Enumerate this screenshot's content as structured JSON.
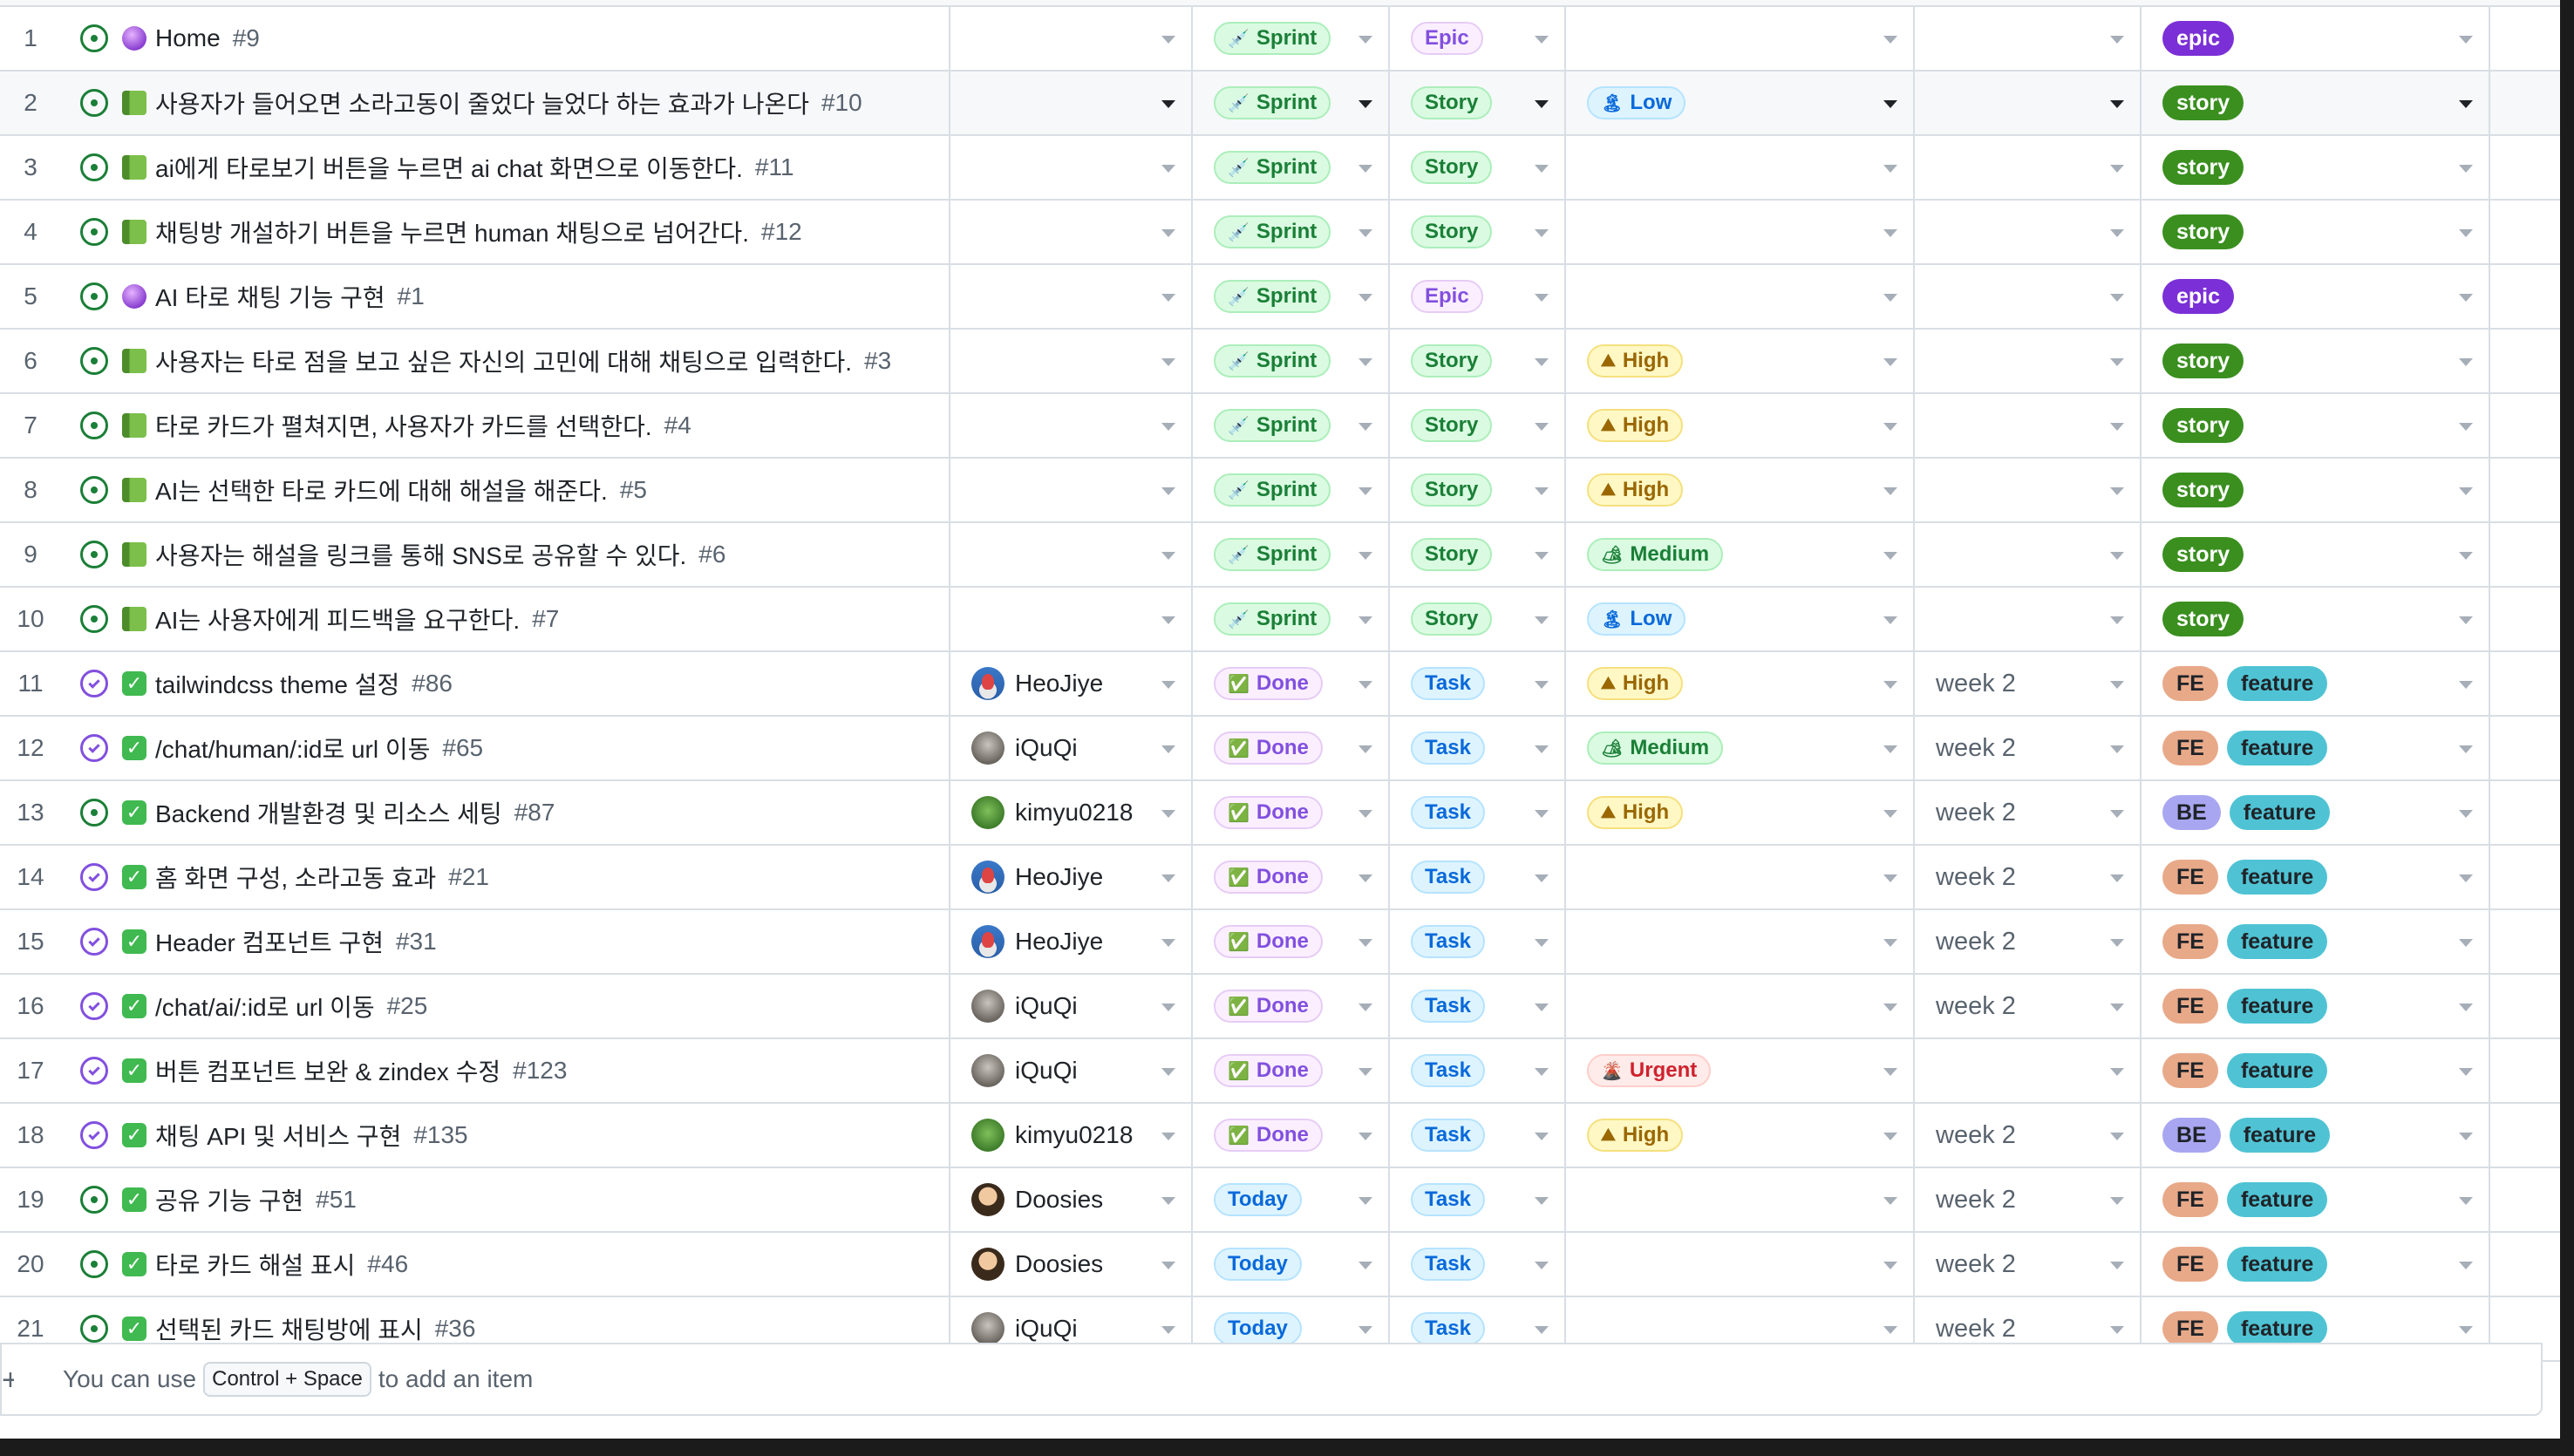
{
  "rows": [
    {
      "num": "1",
      "state": "open",
      "emoji": "crystal",
      "title": "Home",
      "id": "#9",
      "assignee": null,
      "status": {
        "label": "Sprint",
        "kind": "sprint"
      },
      "type": {
        "label": "Epic",
        "kind": "epic"
      },
      "priority": null,
      "iteration": "",
      "labels": [
        {
          "text": "epic",
          "kind": "epic"
        }
      ]
    },
    {
      "num": "2",
      "state": "open",
      "emoji": "book",
      "title": "사용자가 들어오면 소라고동이 줄었다 늘었다 하는 효과가 나온다",
      "id": "#10",
      "assignee": null,
      "status": {
        "label": "Sprint",
        "kind": "sprint"
      },
      "type": {
        "label": "Story",
        "kind": "story"
      },
      "priority": {
        "label": "Low",
        "kind": "low",
        "icon": "🏝"
      },
      "iteration": "",
      "labels": [
        {
          "text": "story",
          "kind": "story"
        }
      ],
      "hover": true
    },
    {
      "num": "3",
      "state": "open",
      "emoji": "book",
      "title": "ai에게 타로보기 버튼을 누르면 ai chat 화면으로 이동한다.",
      "id": "#11",
      "assignee": null,
      "status": {
        "label": "Sprint",
        "kind": "sprint"
      },
      "type": {
        "label": "Story",
        "kind": "story"
      },
      "priority": null,
      "iteration": "",
      "labels": [
        {
          "text": "story",
          "kind": "story"
        }
      ]
    },
    {
      "num": "4",
      "state": "open",
      "emoji": "book",
      "title": "채팅방 개설하기 버튼을 누르면 human 채팅으로 넘어간다.",
      "id": "#12",
      "assignee": null,
      "status": {
        "label": "Sprint",
        "kind": "sprint"
      },
      "type": {
        "label": "Story",
        "kind": "story"
      },
      "priority": null,
      "iteration": "",
      "labels": [
        {
          "text": "story",
          "kind": "story"
        }
      ]
    },
    {
      "num": "5",
      "state": "open",
      "emoji": "crystal",
      "title": "AI 타로 채팅 기능 구현",
      "id": "#1",
      "assignee": null,
      "status": {
        "label": "Sprint",
        "kind": "sprint"
      },
      "type": {
        "label": "Epic",
        "kind": "epic"
      },
      "priority": null,
      "iteration": "",
      "labels": [
        {
          "text": "epic",
          "kind": "epic"
        }
      ]
    },
    {
      "num": "6",
      "state": "open",
      "emoji": "book",
      "title": "사용자는 타로 점을 보고 싶은 자신의 고민에 대해 채팅으로 입력한다.",
      "id": "#3",
      "assignee": null,
      "status": {
        "label": "Sprint",
        "kind": "sprint"
      },
      "type": {
        "label": "Story",
        "kind": "story"
      },
      "priority": {
        "label": "High",
        "kind": "high",
        "icon": "⛰"
      },
      "iteration": "",
      "labels": [
        {
          "text": "story",
          "kind": "story"
        }
      ]
    },
    {
      "num": "7",
      "state": "open",
      "emoji": "book",
      "title": "타로 카드가 펼쳐지면, 사용자가 카드를 선택한다.",
      "id": "#4",
      "assignee": null,
      "status": {
        "label": "Sprint",
        "kind": "sprint"
      },
      "type": {
        "label": "Story",
        "kind": "story"
      },
      "priority": {
        "label": "High",
        "kind": "high",
        "icon": "⛰"
      },
      "iteration": "",
      "labels": [
        {
          "text": "story",
          "kind": "story"
        }
      ]
    },
    {
      "num": "8",
      "state": "open",
      "emoji": "book",
      "title": "AI는 선택한 타로 카드에 대해 해설을 해준다.",
      "id": "#5",
      "assignee": null,
      "status": {
        "label": "Sprint",
        "kind": "sprint"
      },
      "type": {
        "label": "Story",
        "kind": "story"
      },
      "priority": {
        "label": "High",
        "kind": "high",
        "icon": "⛰"
      },
      "iteration": "",
      "labels": [
        {
          "text": "story",
          "kind": "story"
        }
      ]
    },
    {
      "num": "9",
      "state": "open",
      "emoji": "book",
      "title": "사용자는 해설을 링크를 통해 SNS로 공유할 수 있다.",
      "id": "#6",
      "assignee": null,
      "status": {
        "label": "Sprint",
        "kind": "sprint"
      },
      "type": {
        "label": "Story",
        "kind": "story"
      },
      "priority": {
        "label": "Medium",
        "kind": "medium",
        "icon": "🏕"
      },
      "iteration": "",
      "labels": [
        {
          "text": "story",
          "kind": "story"
        }
      ]
    },
    {
      "num": "10",
      "state": "open",
      "emoji": "book",
      "title": "AI는 사용자에게 피드백을 요구한다.",
      "id": "#7",
      "assignee": null,
      "status": {
        "label": "Sprint",
        "kind": "sprint"
      },
      "type": {
        "label": "Story",
        "kind": "story"
      },
      "priority": {
        "label": "Low",
        "kind": "low",
        "icon": "🏝"
      },
      "iteration": "",
      "labels": [
        {
          "text": "story",
          "kind": "story"
        }
      ]
    },
    {
      "num": "11",
      "state": "closed",
      "emoji": "check",
      "title": "tailwindcss theme 설정",
      "id": "#86",
      "assignee": {
        "name": "HeoJiye",
        "av": "heo"
      },
      "status": {
        "label": "Done",
        "kind": "done"
      },
      "type": {
        "label": "Task",
        "kind": "task"
      },
      "priority": {
        "label": "High",
        "kind": "high",
        "icon": "⛰"
      },
      "iteration": "week 2",
      "labels": [
        {
          "text": "FE",
          "kind": "fe"
        },
        {
          "text": "feature",
          "kind": "feature"
        }
      ]
    },
    {
      "num": "12",
      "state": "closed",
      "emoji": "check",
      "title": "/chat/human/:id로 url 이동",
      "id": "#65",
      "assignee": {
        "name": "iQuQi",
        "av": "iqu"
      },
      "status": {
        "label": "Done",
        "kind": "done"
      },
      "type": {
        "label": "Task",
        "kind": "task"
      },
      "priority": {
        "label": "Medium",
        "kind": "medium",
        "icon": "🏕"
      },
      "iteration": "week 2",
      "labels": [
        {
          "text": "FE",
          "kind": "fe"
        },
        {
          "text": "feature",
          "kind": "feature"
        }
      ]
    },
    {
      "num": "13",
      "state": "open",
      "emoji": "check",
      "title": "Backend 개발환경 및 리소스 세팅",
      "id": "#87",
      "assignee": {
        "name": "kimyu0218",
        "av": "kim"
      },
      "status": {
        "label": "Done",
        "kind": "done"
      },
      "type": {
        "label": "Task",
        "kind": "task"
      },
      "priority": {
        "label": "High",
        "kind": "high",
        "icon": "⛰"
      },
      "iteration": "week 2",
      "labels": [
        {
          "text": "BE",
          "kind": "be"
        },
        {
          "text": "feature",
          "kind": "feature"
        }
      ]
    },
    {
      "num": "14",
      "state": "closed",
      "emoji": "check",
      "title": "홈 화면 구성, 소라고동 효과",
      "id": "#21",
      "assignee": {
        "name": "HeoJiye",
        "av": "heo"
      },
      "status": {
        "label": "Done",
        "kind": "done"
      },
      "type": {
        "label": "Task",
        "kind": "task"
      },
      "priority": null,
      "iteration": "week 2",
      "labels": [
        {
          "text": "FE",
          "kind": "fe"
        },
        {
          "text": "feature",
          "kind": "feature"
        }
      ]
    },
    {
      "num": "15",
      "state": "closed",
      "emoji": "check",
      "title": "Header 컴포넌트 구현",
      "id": "#31",
      "assignee": {
        "name": "HeoJiye",
        "av": "heo"
      },
      "status": {
        "label": "Done",
        "kind": "done"
      },
      "type": {
        "label": "Task",
        "kind": "task"
      },
      "priority": null,
      "iteration": "week 2",
      "labels": [
        {
          "text": "FE",
          "kind": "fe"
        },
        {
          "text": "feature",
          "kind": "feature"
        }
      ]
    },
    {
      "num": "16",
      "state": "closed",
      "emoji": "check",
      "title": "/chat/ai/:id로 url 이동",
      "id": "#25",
      "assignee": {
        "name": "iQuQi",
        "av": "iqu"
      },
      "status": {
        "label": "Done",
        "kind": "done"
      },
      "type": {
        "label": "Task",
        "kind": "task"
      },
      "priority": null,
      "iteration": "week 2",
      "labels": [
        {
          "text": "FE",
          "kind": "fe"
        },
        {
          "text": "feature",
          "kind": "feature"
        }
      ]
    },
    {
      "num": "17",
      "state": "closed",
      "emoji": "check",
      "title": "버튼 컴포넌트 보완 & zindex 수정",
      "id": "#123",
      "assignee": {
        "name": "iQuQi",
        "av": "iqu"
      },
      "status": {
        "label": "Done",
        "kind": "done"
      },
      "type": {
        "label": "Task",
        "kind": "task"
      },
      "priority": {
        "label": "Urgent",
        "kind": "urgent",
        "icon": "🌋"
      },
      "iteration": "",
      "labels": [
        {
          "text": "FE",
          "kind": "fe"
        },
        {
          "text": "feature",
          "kind": "feature"
        }
      ]
    },
    {
      "num": "18",
      "state": "closed",
      "emoji": "check",
      "title": "채팅 API 및 서비스 구현",
      "id": "#135",
      "assignee": {
        "name": "kimyu0218",
        "av": "kim"
      },
      "status": {
        "label": "Done",
        "kind": "done"
      },
      "type": {
        "label": "Task",
        "kind": "task"
      },
      "priority": {
        "label": "High",
        "kind": "high",
        "icon": "⛰"
      },
      "iteration": "week 2",
      "labels": [
        {
          "text": "BE",
          "kind": "be"
        },
        {
          "text": "feature",
          "kind": "feature"
        }
      ]
    },
    {
      "num": "19",
      "state": "open",
      "emoji": "check",
      "title": "공유 기능 구현",
      "id": "#51",
      "assignee": {
        "name": "Doosies",
        "av": "doo"
      },
      "status": {
        "label": "Today",
        "kind": "today"
      },
      "type": {
        "label": "Task",
        "kind": "task"
      },
      "priority": null,
      "iteration": "week 2",
      "labels": [
        {
          "text": "FE",
          "kind": "fe"
        },
        {
          "text": "feature",
          "kind": "feature"
        }
      ]
    },
    {
      "num": "20",
      "state": "open",
      "emoji": "check",
      "title": "타로 카드 해설 표시",
      "id": "#46",
      "assignee": {
        "name": "Doosies",
        "av": "doo"
      },
      "status": {
        "label": "Today",
        "kind": "today"
      },
      "type": {
        "label": "Task",
        "kind": "task"
      },
      "priority": null,
      "iteration": "week 2",
      "labels": [
        {
          "text": "FE",
          "kind": "fe"
        },
        {
          "text": "feature",
          "kind": "feature"
        }
      ]
    },
    {
      "num": "21",
      "state": "open",
      "emoji": "check",
      "title": "선택된 카드 채팅방에 표시",
      "id": "#36",
      "assignee": {
        "name": "iQuQi",
        "av": "iqu"
      },
      "status": {
        "label": "Today",
        "kind": "today"
      },
      "type": {
        "label": "Task",
        "kind": "task"
      },
      "priority": null,
      "iteration": "week 2",
      "labels": [
        {
          "text": "FE",
          "kind": "fe"
        },
        {
          "text": "feature",
          "kind": "feature"
        }
      ]
    }
  ],
  "footer": {
    "prefix": "You can use",
    "shortcut": "Control + Space",
    "suffix": "to add an item",
    "add_icon": "plus-icon"
  },
  "colors": {
    "open_state": "#1a7f37",
    "closed_state": "#8250df",
    "label_epic": "#7b2fd6",
    "label_story": "#3a8f1f",
    "label_fe": "#e8a989",
    "label_be": "#a8a6f0",
    "label_feature": "#4fc3d4"
  }
}
